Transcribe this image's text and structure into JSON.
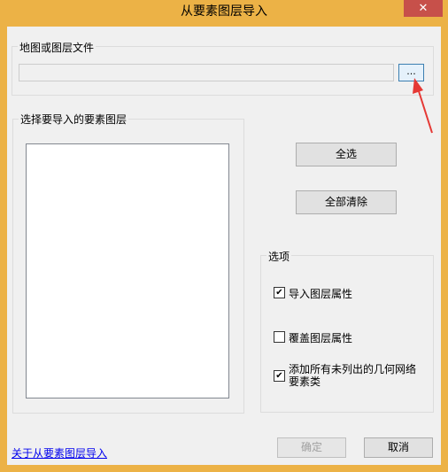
{
  "window": {
    "title": "从要素图层导入",
    "close_label": "✕"
  },
  "file_group": {
    "legend": "地图或图层文件",
    "path_value": "",
    "browse_label": "..."
  },
  "layer_group": {
    "legend": "选择要导入的要素图层",
    "items": []
  },
  "buttons": {
    "select_all": "全选",
    "clear_all": "全部清除",
    "ok": "确定",
    "cancel": "取消"
  },
  "options": {
    "legend": "选项",
    "import_attributes": {
      "label": "导入图层属性",
      "checked": "✔"
    },
    "overwrite_attributes": {
      "label": "覆盖图层属性",
      "checked": ""
    },
    "add_unlisted": {
      "label": "添加所有未列出的几何网络要素类",
      "checked": "✔"
    }
  },
  "help_link": "关于从要素图层导入",
  "annotation": {
    "arrow_color": "#e53935"
  }
}
